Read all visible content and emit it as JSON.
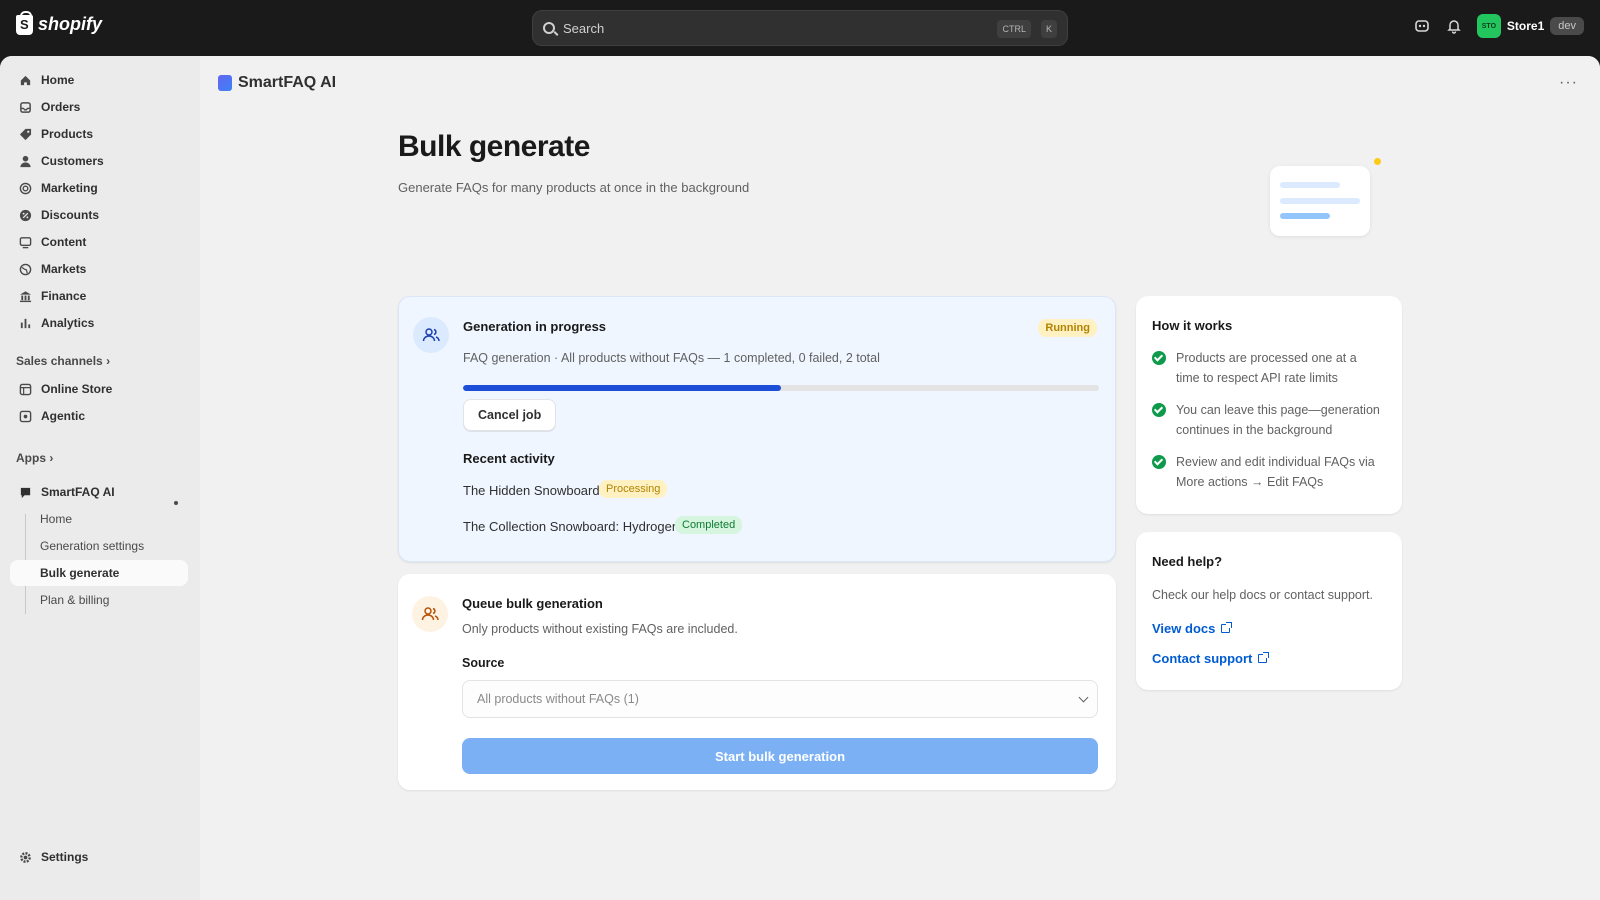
{
  "topbar": {
    "brand": "shopify",
    "search_placeholder": "Search",
    "kbd_ctrl": "CTRL",
    "kbd_k": "K",
    "store_avatar": "STO",
    "store_name": "Store1",
    "store_badge": "dev"
  },
  "sidebar": {
    "items": [
      {
        "label": "Home",
        "icon": "home-icon"
      },
      {
        "label": "Orders",
        "icon": "orders-icon"
      },
      {
        "label": "Products",
        "icon": "tag-icon"
      },
      {
        "label": "Customers",
        "icon": "person-icon"
      },
      {
        "label": "Marketing",
        "icon": "target-icon"
      },
      {
        "label": "Discounts",
        "icon": "discount-icon"
      },
      {
        "label": "Content",
        "icon": "content-icon"
      },
      {
        "label": "Markets",
        "icon": "globe-icon"
      },
      {
        "label": "Finance",
        "icon": "bank-icon"
      },
      {
        "label": "Analytics",
        "icon": "chart-icon"
      }
    ],
    "sales_channels_label": "Sales channels",
    "channels": [
      {
        "label": "Online Store",
        "icon": "store-icon"
      },
      {
        "label": "Agentic",
        "icon": "agentic-icon"
      }
    ],
    "apps_label": "Apps",
    "app_name": "SmartFAQ AI",
    "app_sub": [
      "Home",
      "Generation settings",
      "Bulk generate",
      "Plan & billing"
    ],
    "settings_label": "Settings"
  },
  "main": {
    "app_title": "SmartFAQ AI",
    "more": "···",
    "page_title": "Bulk generate",
    "page_subtitle": "Generate FAQs for many products at once in the background"
  },
  "progress_card": {
    "title": "Generation in progress",
    "status": "Running",
    "summary": "FAQ generation · All products without FAQs — 1 completed, 0 failed, 2 total",
    "progress_fraction": 0.5,
    "cancel_label": "Cancel job",
    "recent_title": "Recent activity",
    "activity": [
      {
        "name": "The Hidden Snowboard",
        "status": "Processing"
      },
      {
        "name": "The Collection Snowboard: Hydrogen",
        "status": "Completed"
      }
    ]
  },
  "queue_card": {
    "title": "Queue bulk generation",
    "subtitle": "Only products without existing FAQs are included.",
    "source_label": "Source",
    "source_value": "All products without FAQs (1)",
    "start_label": "Start bulk generation"
  },
  "how_card": {
    "title": "How it works",
    "items": [
      "Products are processed one at a time to respect API rate limits",
      "You can leave this page—generation continues in the background",
      "Review and edit individual FAQs via More actions → Edit FAQs"
    ]
  },
  "help_card": {
    "title": "Need help?",
    "text": "Check our help docs or contact support.",
    "docs_label": "View docs",
    "support_label": "Contact support"
  },
  "colors": {
    "accent": "#005bd3",
    "progress": "#1d4ed8",
    "running_bg": "#fff1c2",
    "completed_bg": "#d6f5de"
  }
}
